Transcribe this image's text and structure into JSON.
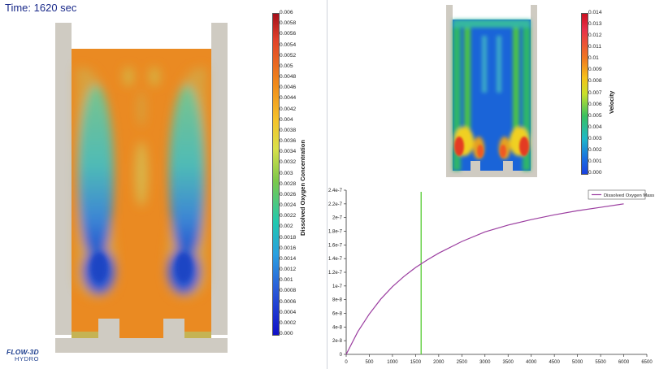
{
  "time_label": "Time: 1620 sec",
  "logo": {
    "line1": "FLOW-3D",
    "line2": "HYDRO"
  },
  "colorbars": {
    "oxygen": {
      "title": "Dissolved Oxygen Concentration",
      "ticks": [
        "0.006",
        "0.0058",
        "0.0056",
        "0.0054",
        "0.0052",
        "0.005",
        "0.0048",
        "0.0046",
        "0.0044",
        "0.0042",
        "0.004",
        "0.0038",
        "0.0036",
        "0.0034",
        "0.0032",
        "0.003",
        "0.0028",
        "0.0026",
        "0.0024",
        "0.0022",
        "0.002",
        "0.0018",
        "0.0016",
        "0.0014",
        "0.0012",
        "0.001",
        "0.0008",
        "0.0006",
        "0.0004",
        "0.0002",
        "0.000"
      ]
    },
    "velocity": {
      "title": "Velocity",
      "ticks": [
        "0.014",
        "0.013",
        "0.012",
        "0.011",
        "0.01",
        "0.009",
        "0.008",
        "0.007",
        "0.006",
        "0.005",
        "0.004",
        "0.003",
        "0.002",
        "0.001",
        "0.000"
      ]
    }
  },
  "chart_data": {
    "type": "line",
    "legend_position": "top-right",
    "grid": false,
    "xlim": [
      0,
      6500
    ],
    "ylim": [
      0,
      2.4e-07
    ],
    "x_ticks": [
      "0",
      "500",
      "1000",
      "1500",
      "2000",
      "2500",
      "3000",
      "3500",
      "4000",
      "4500",
      "5000",
      "5500",
      "6000",
      "6500"
    ],
    "y_ticks": [
      "0",
      "2e-8",
      "4e-8",
      "6e-8",
      "8e-8",
      "1e-7",
      "1.2e-7",
      "1.4e-7",
      "1.6e-7",
      "1.8e-7",
      "2e-7",
      "2.2e-7",
      "2.4e-7"
    ],
    "marker_x": 1620,
    "marker_color": "#55cc33",
    "series": [
      {
        "name": "Dissolved Oxygen Mass",
        "color": "#9b3ea0",
        "x": [
          0,
          250,
          500,
          750,
          1000,
          1250,
          1500,
          1750,
          2000,
          2500,
          3000,
          3500,
          4000,
          4500,
          5000,
          5500,
          6000
        ],
        "y": [
          0,
          3.3e-08,
          5.9e-08,
          8.1e-08,
          9.9e-08,
          1.14e-07,
          1.27e-07,
          1.38e-07,
          1.48e-07,
          1.65e-07,
          1.79e-07,
          1.89e-07,
          1.97e-07,
          2.04e-07,
          2.1e-07,
          2.15e-07,
          2.2e-07
        ]
      }
    ]
  },
  "colors": {
    "wall": "#cfcbc2",
    "oxygen_high": "#ea8a22",
    "oxygen_low": "#2c5ed0",
    "velocity_low": "#1a5fd8",
    "velocity_high": "#e22b22",
    "time_text": "#1a2a8a"
  }
}
